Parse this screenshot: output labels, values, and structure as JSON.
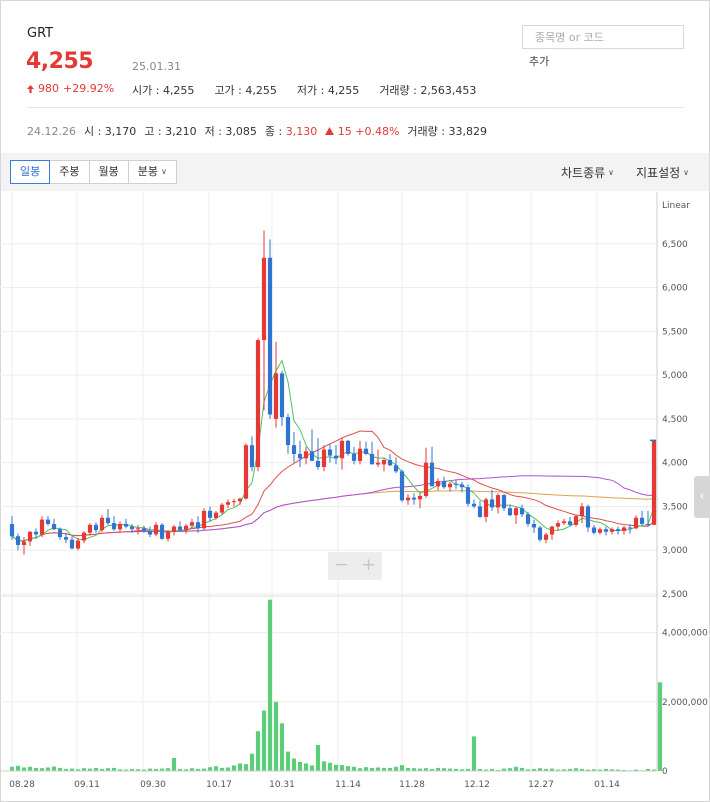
{
  "stock": {
    "name": "GRT",
    "price": "4,255",
    "date": "25.01.31",
    "change_abs": "980",
    "change_pct": "+29.92%",
    "open": "시가 : 4,255",
    "high": "고가 : 4,255",
    "low": "저가 : 4,255",
    "volume": "거래량 : 2,563,453"
  },
  "search": {
    "placeholder": "종목명 or 코드",
    "add_label": "추가"
  },
  "prev": {
    "date": "24.12.26",
    "open": "시 : 3,170",
    "high": "고 : 3,210",
    "low": "저 : 3,085",
    "close_label": "종 :",
    "close_value": "3,130",
    "change": "15 +0.48%",
    "volume": "거래량 : 33,829"
  },
  "toolbar": {
    "tabs": [
      "일봉",
      "주봉",
      "월봉",
      "분봉"
    ],
    "chart_type": "차트종류",
    "indicator": "지표설정"
  },
  "colors": {
    "up": "#e53935",
    "down": "#2f74d0",
    "ma5": "#50c060",
    "ma20": "#e05050",
    "ma60": "#b050d8",
    "ma120": "#e0a050",
    "volume": "#5cce7a"
  },
  "chart_data": {
    "type": "candlestick",
    "scale": "Linear",
    "price_ylim": [
      2500,
      7000
    ],
    "price_ticks": [
      "6,500",
      "6,000",
      "5,500",
      "5,000",
      "4,500",
      "4,000",
      "3,500",
      "3,000",
      "2,500"
    ],
    "volume_ylim": [
      0,
      5000000
    ],
    "volume_ticks": [
      "4,000,000",
      "2,000,000",
      "0"
    ],
    "x_ticks": [
      "08.28",
      "09.11",
      "09.30",
      "10.17",
      "10.31",
      "11.14",
      "11.28",
      "12.12",
      "12.27",
      "01.14"
    ],
    "candles": [
      [
        3300,
        3390,
        3120,
        3160
      ],
      [
        3160,
        3190,
        3000,
        3060
      ],
      [
        3060,
        3150,
        2950,
        3100
      ],
      [
        3100,
        3220,
        3050,
        3210
      ],
      [
        3210,
        3250,
        3130,
        3180
      ],
      [
        3180,
        3390,
        3150,
        3350
      ],
      [
        3350,
        3390,
        3280,
        3300
      ],
      [
        3300,
        3360,
        3230,
        3240
      ],
      [
        3240,
        3260,
        3120,
        3150
      ],
      [
        3150,
        3200,
        3080,
        3120
      ],
      [
        3120,
        3160,
        3010,
        3020
      ],
      [
        3020,
        3140,
        3000,
        3110
      ],
      [
        3110,
        3220,
        3080,
        3200
      ],
      [
        3200,
        3310,
        3170,
        3290
      ],
      [
        3290,
        3320,
        3200,
        3230
      ],
      [
        3230,
        3400,
        3210,
        3370
      ],
      [
        3370,
        3470,
        3290,
        3310
      ],
      [
        3310,
        3390,
        3220,
        3240
      ],
      [
        3240,
        3330,
        3200,
        3300
      ],
      [
        3300,
        3360,
        3250,
        3270
      ],
      [
        3270,
        3300,
        3200,
        3240
      ],
      [
        3240,
        3290,
        3180,
        3250
      ],
      [
        3250,
        3280,
        3200,
        3220
      ],
      [
        3220,
        3270,
        3150,
        3180
      ],
      [
        3180,
        3320,
        3160,
        3290
      ],
      [
        3290,
        3310,
        3120,
        3130
      ],
      [
        3130,
        3230,
        3100,
        3210
      ],
      [
        3210,
        3290,
        3170,
        3270
      ],
      [
        3270,
        3330,
        3210,
        3230
      ],
      [
        3230,
        3300,
        3190,
        3280
      ],
      [
        3280,
        3360,
        3250,
        3320
      ],
      [
        3320,
        3390,
        3200,
        3250
      ],
      [
        3250,
        3480,
        3230,
        3450
      ],
      [
        3450,
        3500,
        3330,
        3370
      ],
      [
        3370,
        3450,
        3350,
        3430
      ],
      [
        3430,
        3540,
        3410,
        3520
      ],
      [
        3520,
        3580,
        3480,
        3550
      ],
      [
        3550,
        3590,
        3500,
        3560
      ],
      [
        3560,
        3600,
        3520,
        3590
      ],
      [
        3590,
        4220,
        3580,
        4200
      ],
      [
        4200,
        4300,
        3900,
        3950
      ],
      [
        3950,
        5420,
        3900,
        5400
      ],
      [
        5400,
        6650,
        4600,
        6340
      ],
      [
        6340,
        6550,
        4500,
        4550
      ],
      [
        4500,
        5380,
        4400,
        5020
      ],
      [
        5020,
        5050,
        4420,
        4520
      ],
      [
        4520,
        4560,
        4100,
        4200
      ],
      [
        4200,
        4350,
        4000,
        4100
      ],
      [
        4100,
        4250,
        3950,
        4050
      ],
      [
        4050,
        4180,
        3980,
        4130
      ],
      [
        4130,
        4380,
        4020,
        4020
      ],
      [
        4020,
        4280,
        3920,
        3950
      ],
      [
        3950,
        4200,
        3900,
        4150
      ],
      [
        4150,
        4210,
        4000,
        4080
      ],
      [
        4080,
        4200,
        3980,
        4050
      ],
      [
        4050,
        4290,
        3920,
        4250
      ],
      [
        4250,
        4260,
        4080,
        4100
      ],
      [
        4100,
        4180,
        3980,
        4020
      ],
      [
        4020,
        4250,
        3980,
        4160
      ],
      [
        4160,
        4240,
        4090,
        4100
      ],
      [
        4100,
        4240,
        4020,
        3980
      ],
      [
        3980,
        4150,
        3950,
        4000
      ],
      [
        3980,
        4050,
        3900,
        4030
      ],
      [
        4030,
        4100,
        3960,
        3970
      ],
      [
        3970,
        4060,
        3880,
        3900
      ],
      [
        3900,
        3920,
        3550,
        3570
      ],
      [
        3570,
        3640,
        3520,
        3600
      ],
      [
        3600,
        3650,
        3520,
        3580
      ],
      [
        3580,
        3650,
        3480,
        3620
      ],
      [
        3620,
        4170,
        3600,
        4000
      ],
      [
        4000,
        4180,
        3730,
        3730
      ],
      [
        3730,
        3820,
        3680,
        3790
      ],
      [
        3790,
        3840,
        3700,
        3720
      ],
      [
        3720,
        3780,
        3670,
        3760
      ],
      [
        3760,
        3800,
        3700,
        3750
      ],
      [
        3750,
        3780,
        3660,
        3720
      ],
      [
        3720,
        3750,
        3500,
        3530
      ],
      [
        3530,
        3580,
        3480,
        3500
      ],
      [
        3500,
        3560,
        3370,
        3380
      ],
      [
        3380,
        3600,
        3320,
        3580
      ],
      [
        3580,
        3690,
        3450,
        3490
      ],
      [
        3490,
        3650,
        3420,
        3630
      ],
      [
        3630,
        3640,
        3450,
        3480
      ],
      [
        3480,
        3520,
        3390,
        3400
      ],
      [
        3400,
        3500,
        3300,
        3480
      ],
      [
        3480,
        3520,
        3380,
        3410
      ],
      [
        3410,
        3440,
        3270,
        3300
      ],
      [
        3300,
        3350,
        3200,
        3260
      ],
      [
        3260,
        3280,
        3100,
        3120
      ],
      [
        3120,
        3200,
        3080,
        3180
      ],
      [
        3180,
        3280,
        3120,
        3270
      ],
      [
        3270,
        3340,
        3220,
        3310
      ],
      [
        3310,
        3360,
        3290,
        3330
      ],
      [
        3330,
        3380,
        3270,
        3290
      ],
      [
        3290,
        3410,
        3270,
        3390
      ],
      [
        3390,
        3540,
        3310,
        3500
      ],
      [
        3500,
        3520,
        3210,
        3260
      ],
      [
        3260,
        3290,
        3180,
        3200
      ],
      [
        3200,
        3260,
        3180,
        3240
      ],
      [
        3240,
        3270,
        3170,
        3210
      ],
      [
        3210,
        3260,
        3180,
        3240
      ],
      [
        3240,
        3270,
        3180,
        3220
      ],
      [
        3220,
        3280,
        3180,
        3260
      ],
      [
        3260,
        3300,
        3190,
        3250
      ],
      [
        3250,
        3400,
        3240,
        3370
      ],
      [
        3370,
        3450,
        3280,
        3300
      ],
      [
        3300,
        3450,
        3270,
        3290
      ],
      [
        3290,
        4255,
        3290,
        4255
      ]
    ],
    "volume_values": [
      120000,
      150000,
      100000,
      120000,
      90000,
      80000,
      100000,
      130000,
      90000,
      60000,
      70000,
      50000,
      80000,
      70000,
      90000,
      60000,
      80000,
      90000,
      50000,
      40000,
      60000,
      50000,
      40000,
      70000,
      60000,
      70000,
      80000,
      380000,
      60000,
      50000,
      80000,
      60000,
      70000,
      110000,
      140000,
      90000,
      100000,
      160000,
      220000,
      200000,
      500000,
      1150000,
      1750000,
      4950000,
      2000000,
      1380000,
      560000,
      360000,
      260000,
      220000,
      160000,
      750000,
      280000,
      240000,
      180000,
      170000,
      140000,
      120000,
      80000,
      110000,
      90000,
      100000,
      90000,
      90000,
      120000,
      170000,
      90000,
      80000,
      70000,
      80000,
      60000,
      90000,
      80000,
      70000,
      60000,
      50000,
      60000,
      1000000,
      60000,
      40000,
      60000,
      30000,
      70000,
      80000,
      120000,
      90000,
      50000,
      60000,
      80000,
      60000,
      70000,
      40000,
      50000,
      60000,
      80000,
      60000,
      40000,
      50000,
      40000,
      60000,
      50000,
      40000,
      30000,
      20000,
      40000,
      20000,
      60000,
      40000,
      2563453
    ]
  }
}
